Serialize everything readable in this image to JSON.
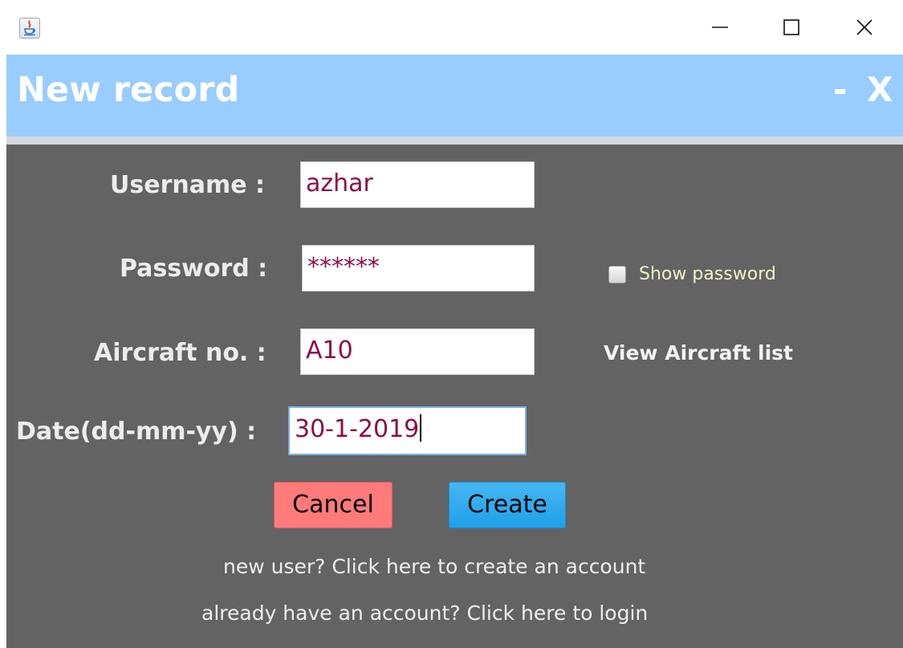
{
  "window": {
    "icon": "java-coffee-icon",
    "controls": {
      "minimize_icon": "minimize-icon",
      "maximize_icon": "maximize-icon",
      "close_icon": "close-icon"
    }
  },
  "header": {
    "title": "New record",
    "minimize_label": "-",
    "close_label": "X",
    "background": "#99ccff"
  },
  "form": {
    "username": {
      "label": "Username :",
      "value": "azhar"
    },
    "password": {
      "label": "Password :",
      "value": "******"
    },
    "aircraft": {
      "label": "Aircraft no. :",
      "value": "A10"
    },
    "date": {
      "label": "Date(dd-mm-yy) :",
      "value": "30-1-2019"
    },
    "show_password_label": "Show password",
    "show_password_checked": false,
    "view_aircraft_list_label": "View Aircraft list"
  },
  "buttons": {
    "cancel_label": "Cancel",
    "create_label": "Create",
    "cancel_color": "#ff7a7a",
    "create_color": "#2aa8ee"
  },
  "links": {
    "signup": "new user? Click here to create an account",
    "login": "already have an account? Click here to login"
  },
  "colors": {
    "panel_background": "#636363",
    "field_text": "#8a0f4a"
  }
}
